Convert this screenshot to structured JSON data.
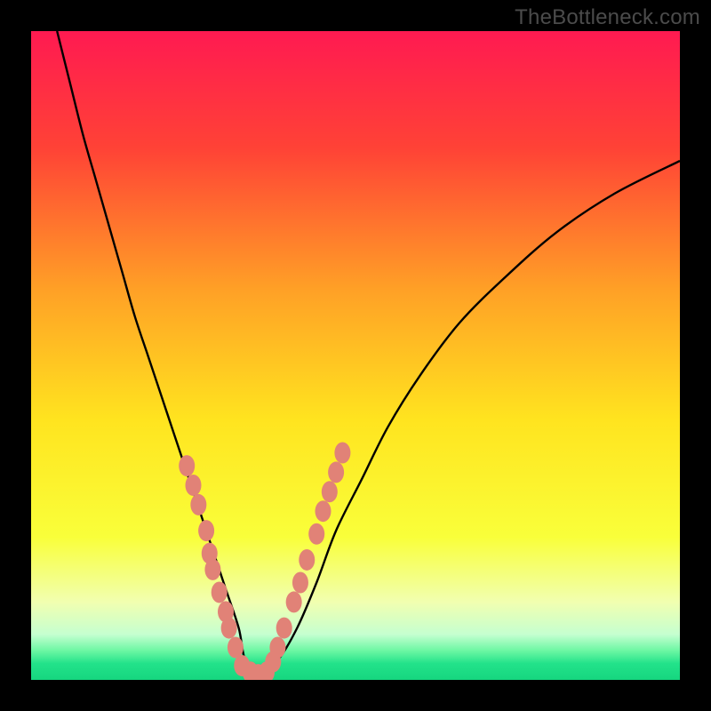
{
  "watermark": "TheBottleneck.com",
  "chart_data": {
    "type": "line",
    "title": "",
    "xlabel": "",
    "ylabel": "",
    "xlim": [
      0,
      100
    ],
    "ylim": [
      0,
      100
    ],
    "gradient_stops": [
      {
        "pos": 0.0,
        "color": "#ff1a51"
      },
      {
        "pos": 0.18,
        "color": "#ff4236"
      },
      {
        "pos": 0.4,
        "color": "#ffa126"
      },
      {
        "pos": 0.6,
        "color": "#ffe41f"
      },
      {
        "pos": 0.78,
        "color": "#f9ff3a"
      },
      {
        "pos": 0.88,
        "color": "#f1ffb0"
      },
      {
        "pos": 0.93,
        "color": "#c5ffd0"
      },
      {
        "pos": 0.955,
        "color": "#6cf7a3"
      },
      {
        "pos": 0.975,
        "color": "#22e28a"
      },
      {
        "pos": 1.0,
        "color": "#16d67f"
      }
    ],
    "series": [
      {
        "name": "bottleneck-curve",
        "x": [
          4,
          6,
          8,
          10,
          12,
          14,
          16,
          18,
          20,
          22,
          24,
          26,
          28,
          30,
          32,
          33,
          35,
          38,
          41,
          44,
          47,
          51,
          55,
          60,
          66,
          73,
          81,
          90,
          100
        ],
        "y": [
          100,
          92,
          84,
          77,
          70,
          63,
          56,
          50,
          44,
          38,
          32,
          26,
          20,
          14,
          8,
          3,
          0.7,
          3,
          8,
          15,
          23,
          31,
          39,
          47,
          55,
          62,
          69,
          75,
          80
        ]
      }
    ],
    "marker_clusters": [
      {
        "name": "left-cluster",
        "color": "#e18277",
        "points": [
          {
            "x": 24.0,
            "y": 33.0
          },
          {
            "x": 25.0,
            "y": 30.0
          },
          {
            "x": 25.8,
            "y": 27.0
          },
          {
            "x": 27.0,
            "y": 23.0
          },
          {
            "x": 27.5,
            "y": 19.5
          },
          {
            "x": 28.0,
            "y": 17.0
          },
          {
            "x": 29.0,
            "y": 13.5
          },
          {
            "x": 30.0,
            "y": 10.5
          },
          {
            "x": 30.5,
            "y": 8.0
          },
          {
            "x": 31.5,
            "y": 5.0
          }
        ]
      },
      {
        "name": "right-cluster",
        "color": "#e18277",
        "points": [
          {
            "x": 38.0,
            "y": 5.0
          },
          {
            "x": 39.0,
            "y": 8.0
          },
          {
            "x": 40.5,
            "y": 12.0
          },
          {
            "x": 41.5,
            "y": 15.0
          },
          {
            "x": 42.5,
            "y": 18.5
          },
          {
            "x": 44.0,
            "y": 22.5
          },
          {
            "x": 45.0,
            "y": 26.0
          },
          {
            "x": 46.0,
            "y": 29.0
          },
          {
            "x": 47.0,
            "y": 32.0
          },
          {
            "x": 48.0,
            "y": 35.0
          }
        ]
      },
      {
        "name": "bottom-cluster",
        "color": "#e18277",
        "points": [
          {
            "x": 32.5,
            "y": 2.2
          },
          {
            "x": 33.8,
            "y": 1.2
          },
          {
            "x": 35.0,
            "y": 0.8
          },
          {
            "x": 36.3,
            "y": 1.2
          },
          {
            "x": 37.3,
            "y": 2.8
          }
        ]
      }
    ]
  }
}
